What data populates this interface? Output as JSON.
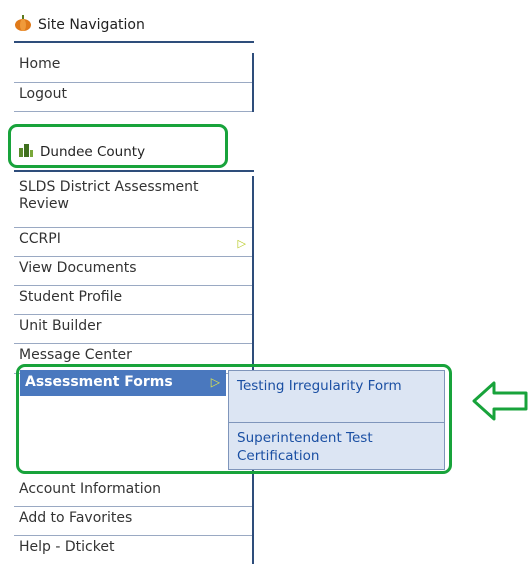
{
  "site_nav": {
    "title": "Site Navigation",
    "icon": "pumpkin-icon",
    "items": [
      {
        "label": "Home"
      },
      {
        "label": "Logout"
      }
    ]
  },
  "district": {
    "title": "Dundee County",
    "icon": "building-icon",
    "items": [
      {
        "label": "SLDS District Assessment Review"
      },
      {
        "label": "CCRPI",
        "has_submenu": true
      },
      {
        "label": "View Documents"
      },
      {
        "label": "Student Profile"
      },
      {
        "label": "Unit Builder"
      },
      {
        "label": "Message Center"
      },
      {
        "label": "Assessment Forms",
        "active": true,
        "has_submenu": true
      },
      {
        "label": "Account Information"
      },
      {
        "label": "Add to Favorites"
      },
      {
        "label": "Help - Dticket"
      }
    ]
  },
  "submenu": {
    "items": [
      {
        "label": "Testing Irregularity Form"
      },
      {
        "label": "Superintendent Test Certification"
      }
    ]
  },
  "colors": {
    "highlight": "#18a33b",
    "active_bg": "#4a78be",
    "submenu_bg": "#dce5f3",
    "nav_border": "#2e4d7b",
    "link": "#1a4fa3"
  },
  "annotation_icon": "left-arrow-icon"
}
